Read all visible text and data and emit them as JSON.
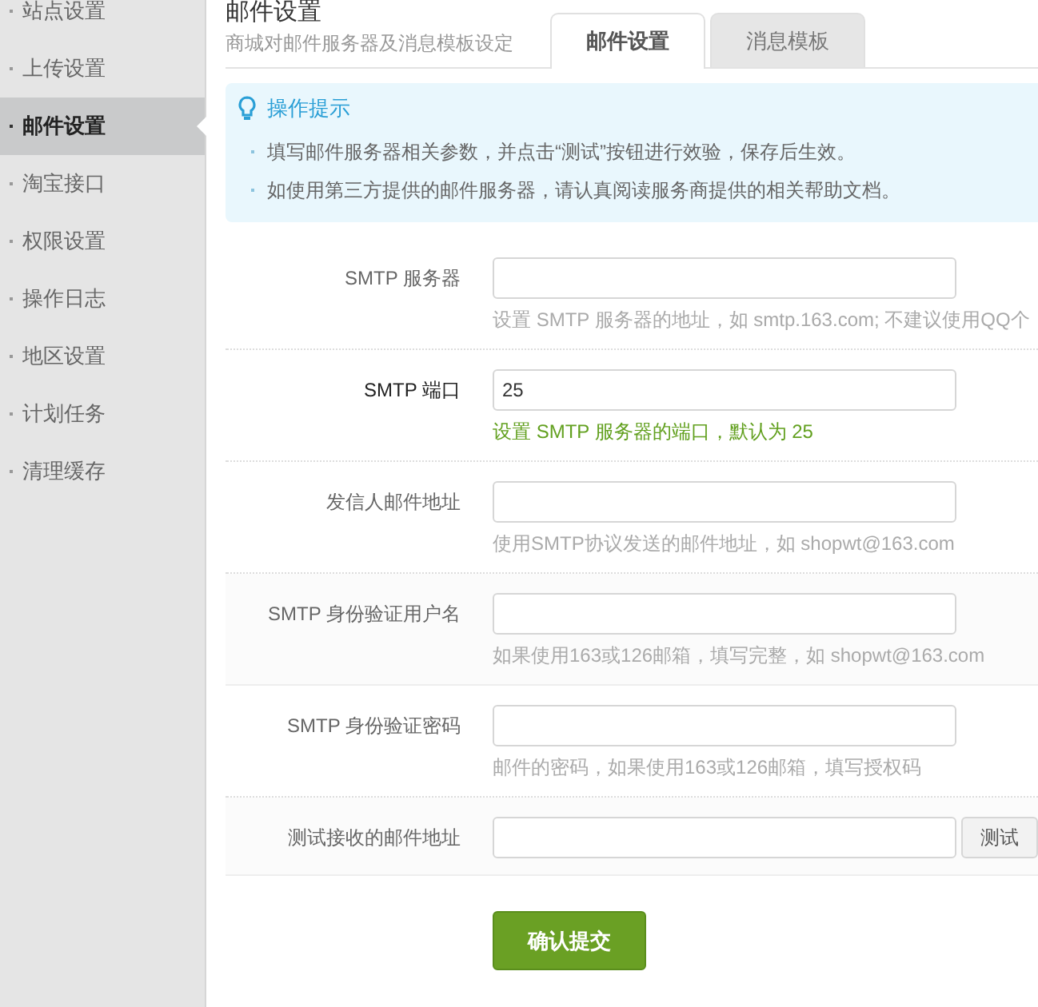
{
  "sidebar": {
    "items": [
      {
        "label": "站点设置",
        "selected": false
      },
      {
        "label": "上传设置",
        "selected": false
      },
      {
        "label": "邮件设置",
        "selected": true
      },
      {
        "label": "淘宝接口",
        "selected": false
      },
      {
        "label": "权限设置",
        "selected": false
      },
      {
        "label": "操作日志",
        "selected": false
      },
      {
        "label": "地区设置",
        "selected": false
      },
      {
        "label": "计划任务",
        "selected": false
      },
      {
        "label": "清理缓存",
        "selected": false
      }
    ]
  },
  "header": {
    "title": "邮件设置",
    "subtitle": "商城对邮件服务器及消息模板设定"
  },
  "tabs": [
    {
      "label": "邮件设置",
      "selected": true
    },
    {
      "label": "消息模板",
      "selected": false
    }
  ],
  "tips": {
    "title": "操作提示",
    "items": [
      "填写邮件服务器相关参数，并点击“测试”按钮进行效验，保存后生效。",
      "如使用第三方提供的邮件服务器，请认真阅读服务商提供的相关帮助文档。"
    ]
  },
  "form": {
    "fields": [
      {
        "label": "SMTP 服务器",
        "hint": "设置 SMTP 服务器的地址，如 smtp.163.com; 不建议使用QQ个",
        "focused": false
      },
      {
        "label": "SMTP 端口",
        "value": "25",
        "hint": "设置 SMTP 服务器的端口，默认为 25",
        "focused": true
      },
      {
        "label": "发信人邮件地址",
        "hint": "使用SMTP协议发送的邮件地址，如 shopwt@163.com",
        "focused": false
      },
      {
        "label": "SMTP 身份验证用户名",
        "hint": "如果使用163或126邮箱，填写完整，如 shopwt@163.com",
        "focused": false
      },
      {
        "label": "SMTP 身份验证密码",
        "hint": "邮件的密码，如果使用163或126邮箱，填写授权码",
        "focused": false
      },
      {
        "label": "测试接收的邮件地址",
        "button": "测试",
        "focused": false
      }
    ],
    "submit": "确认提交"
  }
}
